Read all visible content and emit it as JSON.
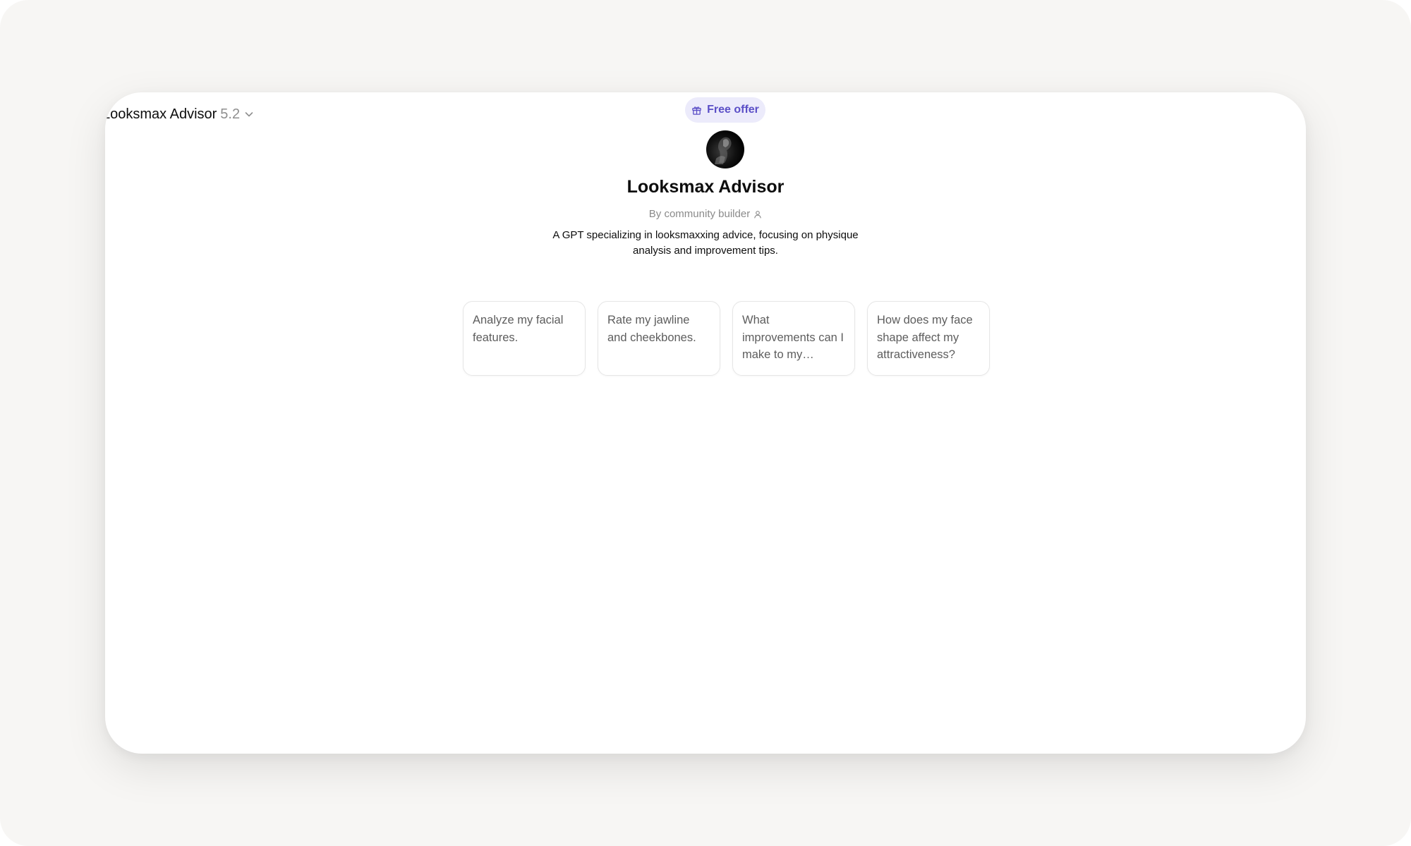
{
  "header": {
    "model_name": "Looksmax Advisor",
    "model_version": "5.2",
    "free_offer_label": "Free offer"
  },
  "gpt": {
    "title": "Looksmax Advisor",
    "byline": "By community builder",
    "description": "A GPT specializing in looksmaxxing advice, focusing on physique analysis and improvement tips."
  },
  "suggestions": [
    "Analyze my facial features.",
    "Rate my jawline and cheekbones.",
    "What improvements can I make to my appearance?",
    "How does my face shape affect my attractiveness?"
  ],
  "icons": {
    "model_dropdown": "chevron-down-icon",
    "offer": "gift-icon",
    "author": "person-icon"
  },
  "colors": {
    "offer_text": "#5b4fc7",
    "offer_background": "#ecebfb",
    "backdrop": "#f7f6f4"
  }
}
